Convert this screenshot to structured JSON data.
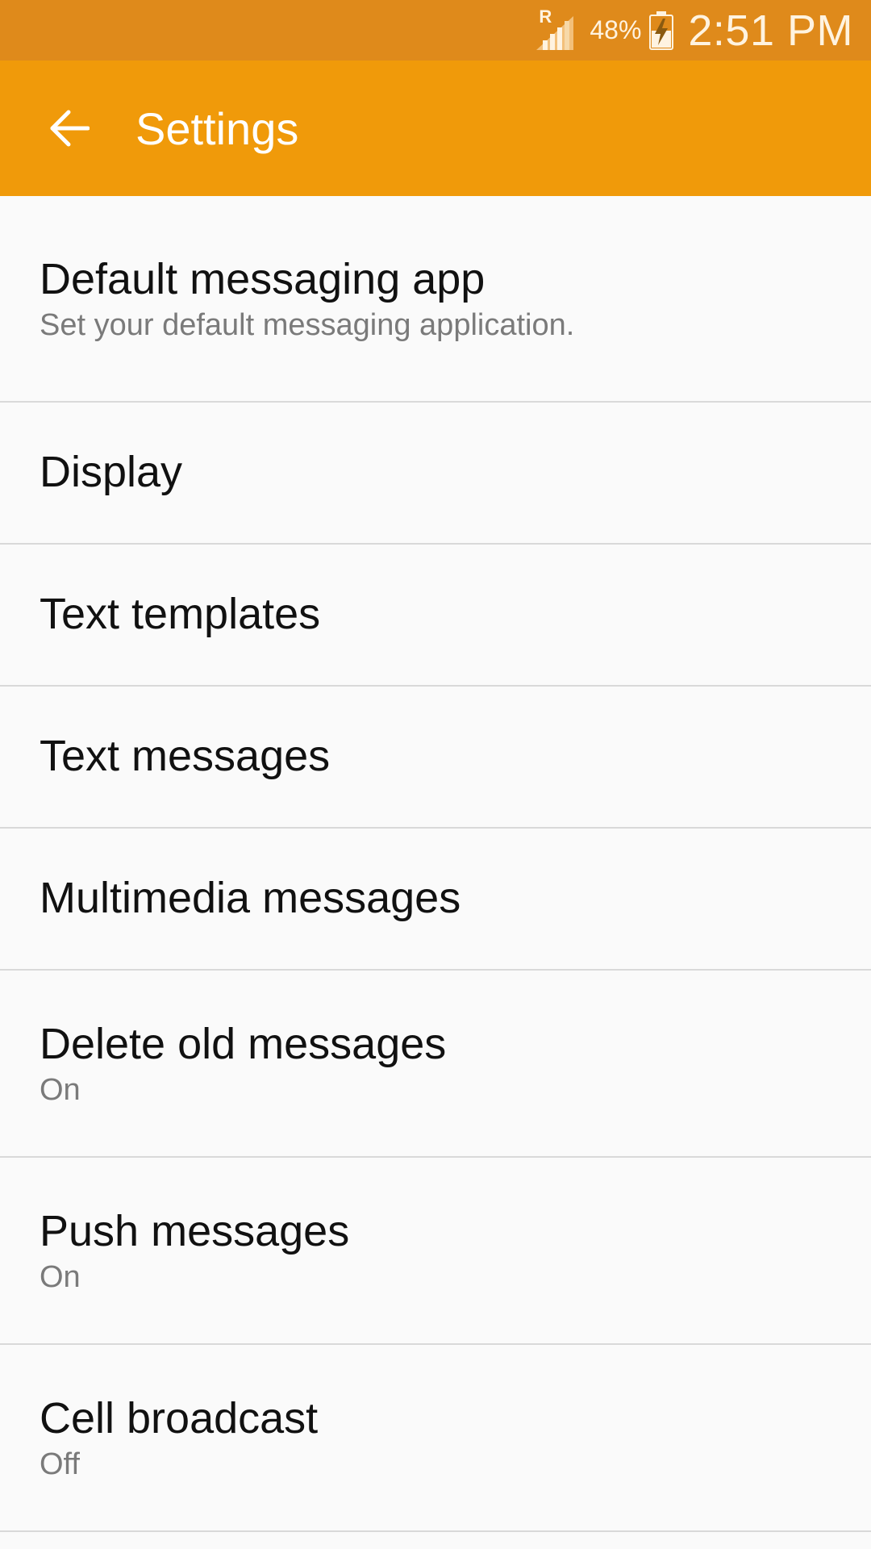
{
  "status_bar": {
    "roaming_indicator": "R",
    "battery_percent": "48%",
    "time": "2:51 PM",
    "icons": [
      "signal-icon",
      "battery-charging-icon"
    ]
  },
  "app_bar": {
    "title": "Settings",
    "back_icon": "arrow-back-icon",
    "background_color": "#f09a0a"
  },
  "settings": [
    {
      "title": "Default messaging app",
      "subtitle": "Set your default messaging application."
    },
    {
      "title": "Display"
    },
    {
      "title": "Text templates"
    },
    {
      "title": "Text messages"
    },
    {
      "title": "Multimedia messages"
    },
    {
      "title": "Delete old messages",
      "subtitle": "On"
    },
    {
      "title": "Push messages",
      "subtitle": "On"
    },
    {
      "title": "Cell broadcast",
      "subtitle": "Off"
    }
  ]
}
